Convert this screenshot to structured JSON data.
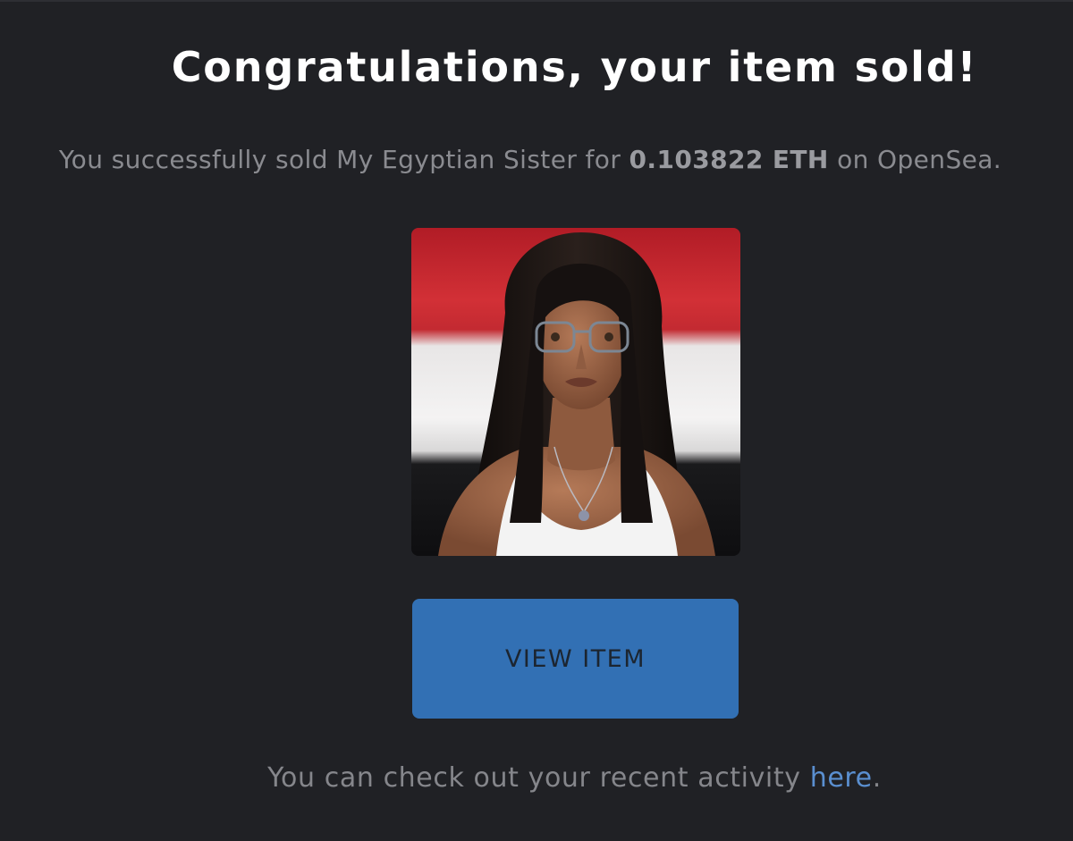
{
  "header": {
    "title": "Congratulations, your item sold!"
  },
  "sale": {
    "prefix": "You successfully sold ",
    "item_name": "My Egyptian Sister",
    "for_text": " for ",
    "price": "0.103822 ETH",
    "suffix": " on OpenSea."
  },
  "item_image": {
    "alt": "My Egyptian Sister"
  },
  "actions": {
    "view_item_label": "VIEW ITEM"
  },
  "footer": {
    "text": "You can check out your recent activity ",
    "link_label": "here",
    "end": "."
  },
  "colors": {
    "background": "#202125",
    "button": "#3270b4",
    "link": "#5a8fd0",
    "flag_red": "#c8202b",
    "flag_white": "#f2f2f2",
    "flag_black": "#111111"
  }
}
